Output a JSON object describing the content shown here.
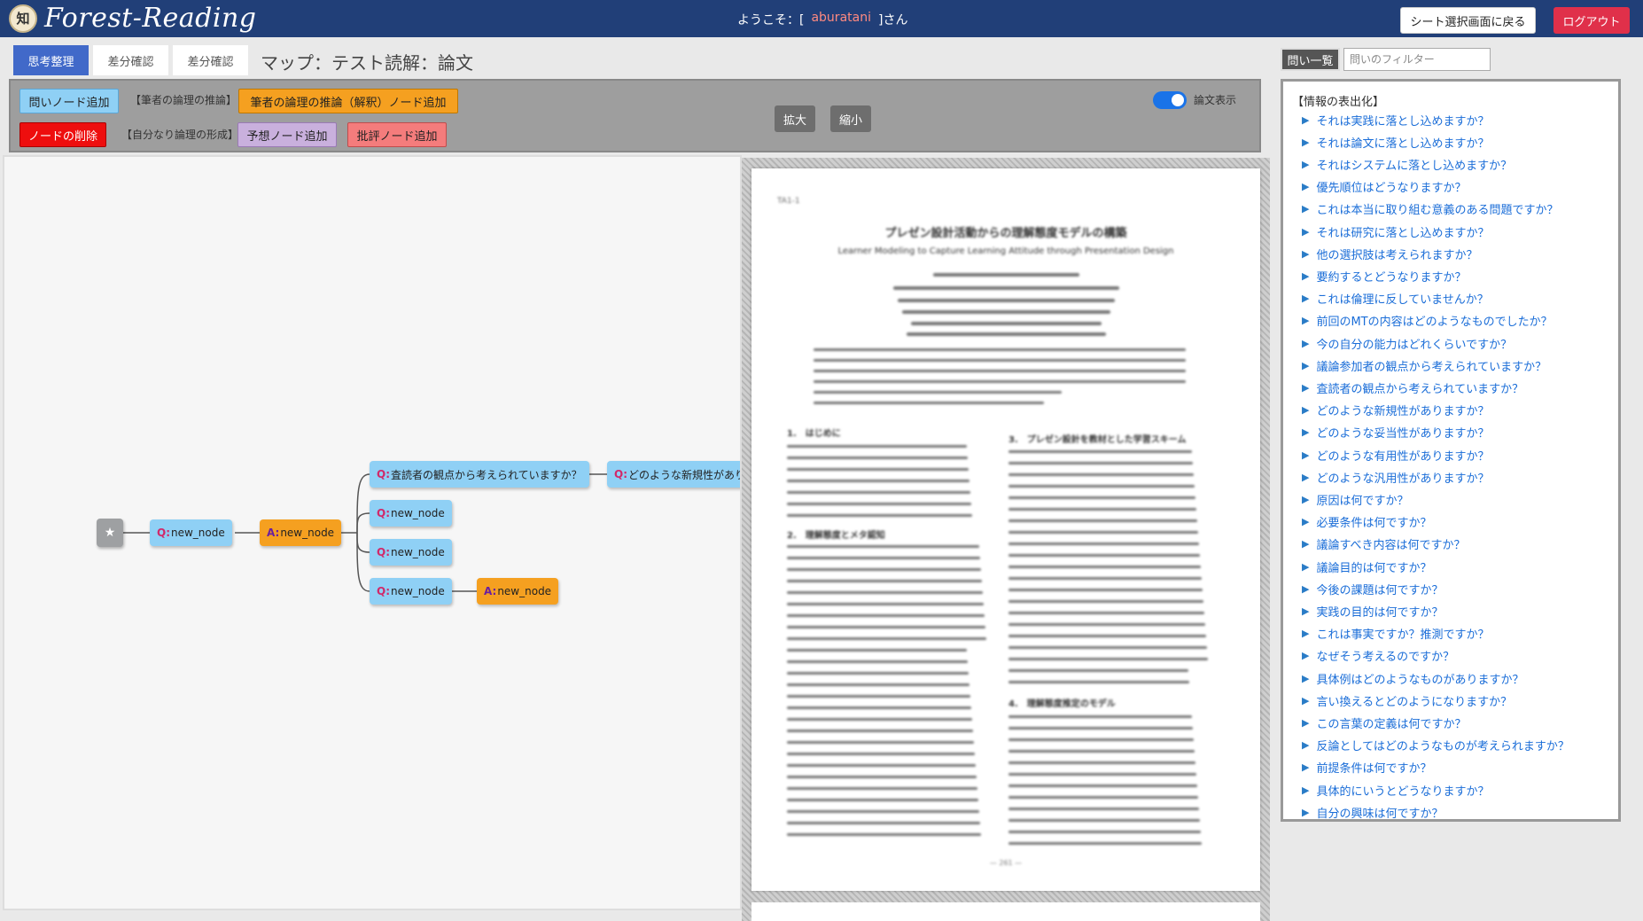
{
  "header": {
    "logo_glyph": "知",
    "logo_text": "Forest-Reading",
    "welcome_prefix": "ようこそ：[",
    "username": "aburatani",
    "welcome_suffix": "]さん",
    "sheet_select_label": "シート選択画面に戻る",
    "logout_label": "ログアウト"
  },
  "tabs": [
    {
      "label": "思考整理",
      "active": true
    },
    {
      "label": "差分確認",
      "active": false
    },
    {
      "label": "差分確認",
      "active": false
    }
  ],
  "map_title": "マップ：テスト読解：論文",
  "toolbar": {
    "add_question": "問いノード追加",
    "author_reasoning_label": "【筆者の論理の推論】",
    "add_author_reasoning": "筆者の論理の推論（解釈）ノード追加",
    "delete_node": "ノードの削除",
    "own_logic_label": "【自分なり論理の形成】",
    "add_prediction": "予想ノード追加",
    "add_critique": "批評ノード追加",
    "zoom_in": "拡大",
    "zoom_out": "縮小",
    "paper_toggle_label": "論文表示",
    "paper_toggle_on": true
  },
  "map": {
    "root_icon": "star-icon",
    "root_glyph": "★",
    "nodes": [
      {
        "id": "n1",
        "prefix": "Q:",
        "label": "new_node",
        "kind": "q"
      },
      {
        "id": "n2",
        "prefix": "A:",
        "label": "new_node",
        "kind": "a"
      },
      {
        "id": "n3",
        "prefix": "Q:",
        "label": "査読者の観点から考えられていますか？",
        "kind": "q"
      },
      {
        "id": "n4",
        "prefix": "Q:",
        "label": "どのような新規性がありますか？",
        "kind": "q"
      },
      {
        "id": "n5",
        "prefix": "Q:",
        "label": "new_node",
        "kind": "q"
      },
      {
        "id": "n6",
        "prefix": "Q:",
        "label": "new_node",
        "kind": "q"
      },
      {
        "id": "n7",
        "prefix": "Q:",
        "label": "new_node",
        "kind": "q"
      },
      {
        "id": "n8",
        "prefix": "A:",
        "label": "new_node",
        "kind": "a"
      }
    ]
  },
  "paper": {
    "code": "TA1-1",
    "title": "プレゼン設計活動からの理解態度モデルの構築",
    "subtitle": "Learner Modeling to Capture Learning Attitude through Presentation Design",
    "section1": "1.　はじめに",
    "section2": "2.　理解態度とメタ認知",
    "section3": "3.　プレゼン設計を教材とした学習スキーム",
    "section4": "4.　理解態度推定のモデル",
    "page_number": "— 261 —"
  },
  "questions": {
    "list_label": "問い一覧",
    "filter_placeholder": "問いのフィルター",
    "category": "【情報の表出化】",
    "items": [
      "それは実践に落とし込めますか？",
      "それは論文に落とし込めますか？",
      "それはシステムに落とし込めますか？",
      "優先順位はどうなりますか？",
      "これは本当に取り組む意義のある問題ですか？",
      "それは研究に落とし込めますか？",
      "他の選択肢は考えられますか？",
      "要約するとどうなりますか？",
      "これは倫理に反していませんか？",
      "前回のMTの内容はどのようなものでしたか？",
      "今の自分の能力はどれくらいですか？",
      "議論参加者の観点から考えられていますか？",
      "査読者の観点から考えられていますか？",
      "どのような新規性がありますか？",
      "どのような妥当性がありますか？",
      "どのような有用性がありますか？",
      "どのような汎用性がありますか？",
      "原因は何ですか？",
      "必要条件は何ですか？",
      "議論すべき内容は何ですか？",
      "議論目的は何ですか？",
      "今後の課題は何ですか？",
      "実践の目的は何ですか？",
      "これは事実ですか？推測ですか？",
      "なぜそう考えるのですか？",
      "具体例はどのようなものがありますか？",
      "言い換えるとどのようになりますか？",
      "この言葉の定義は何ですか？",
      "反論としてはどのようなものが考えられますか？",
      "前提条件は何ですか？",
      "具体的にいうとどうなりますか？",
      "自分の興味は何ですか？"
    ]
  },
  "colors": {
    "header_bg": "#213f78",
    "question_node": "#8fd0f5",
    "answer_node": "#f5a020",
    "logout": "#e0304a",
    "active_tab": "#4169c9",
    "link": "#1a6dd8"
  }
}
